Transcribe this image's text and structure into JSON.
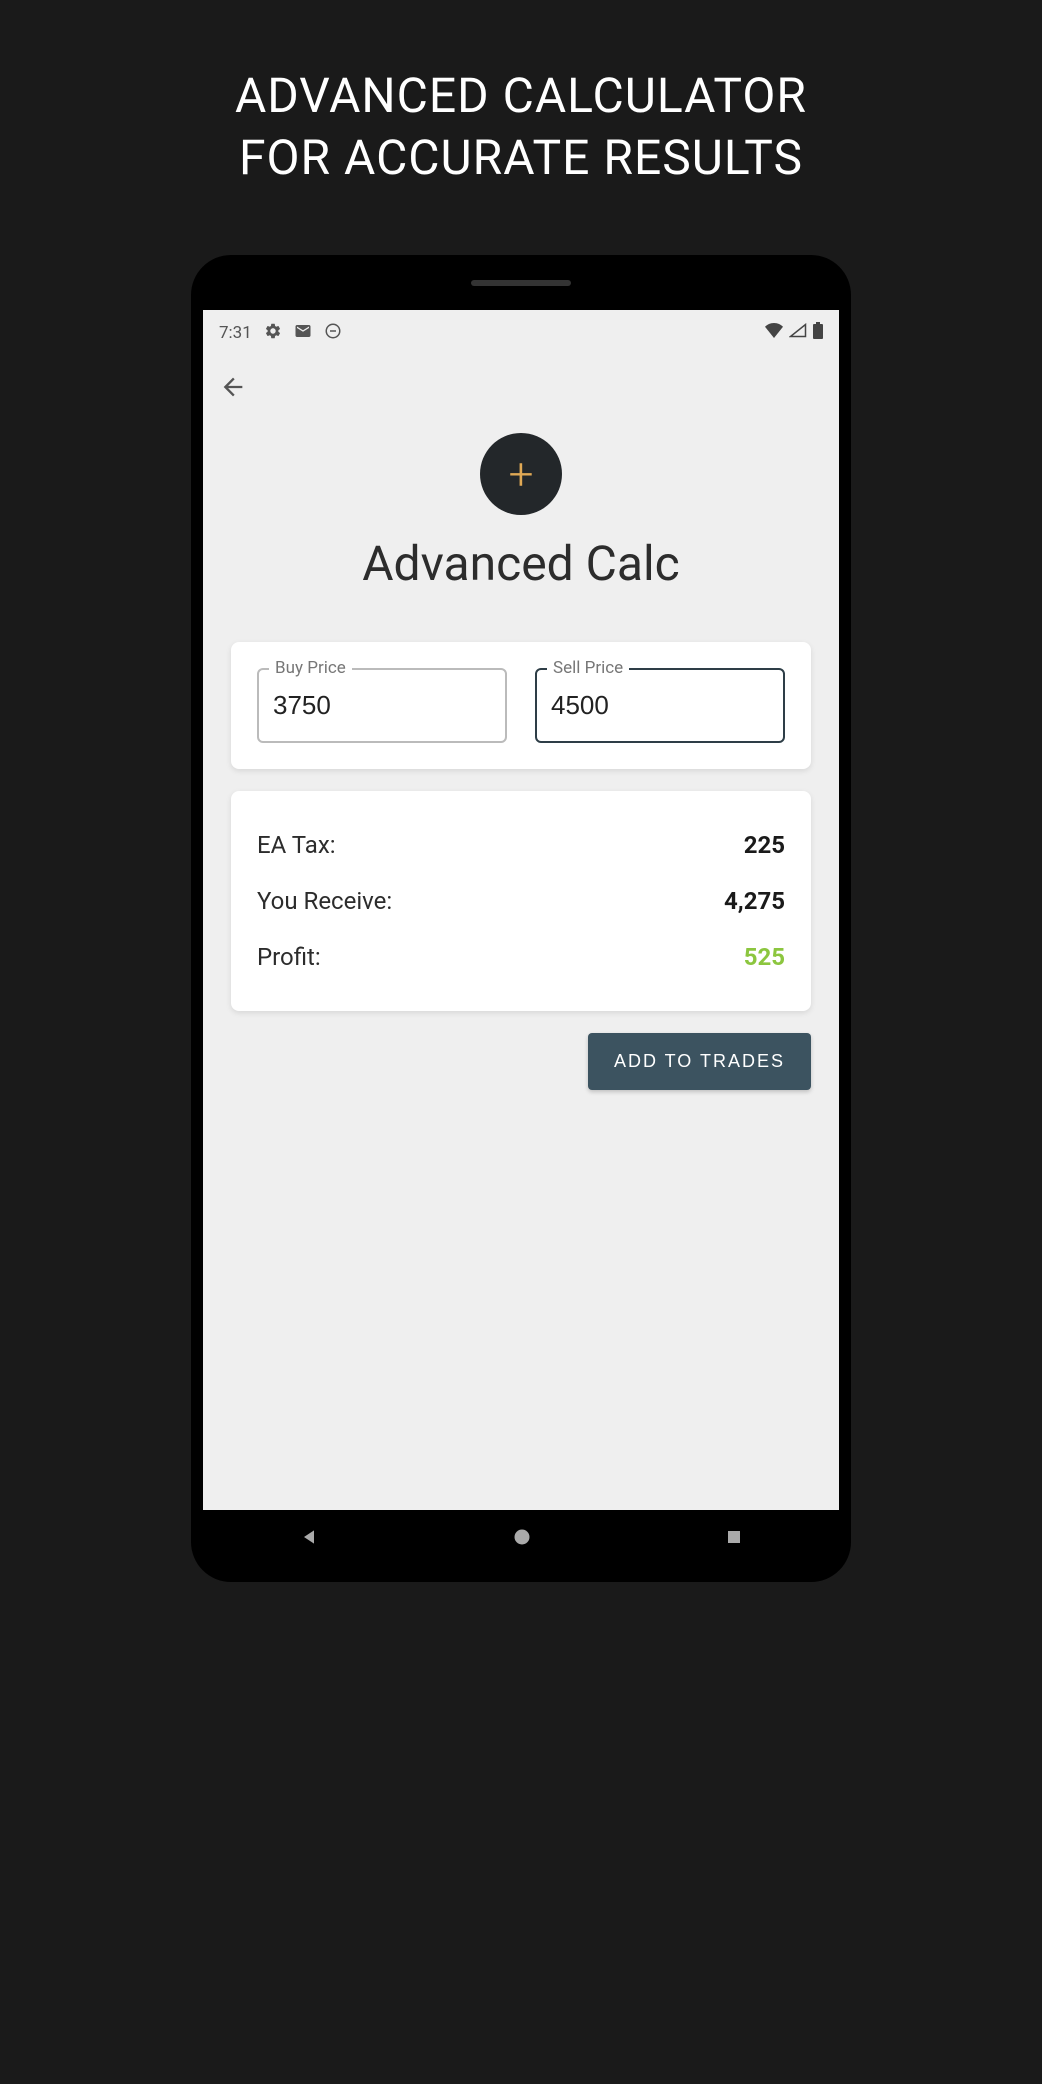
{
  "promo": {
    "line1": "ADVANCED CALCULATOR",
    "line2": "FOR ACCURATE RESULTS"
  },
  "status": {
    "time": "7:31"
  },
  "screen": {
    "title": "Advanced Calc",
    "buy_label": "Buy Price",
    "buy_value": "3750",
    "sell_label": "Sell Price",
    "sell_value": "4500",
    "stats": {
      "ea_tax_label": "EA Tax:",
      "ea_tax_value": "225",
      "receive_label": "You Receive:",
      "receive_value": "4,275",
      "profit_label": "Profit:",
      "profit_value": "525"
    },
    "add_button": "ADD TO TRADES"
  }
}
